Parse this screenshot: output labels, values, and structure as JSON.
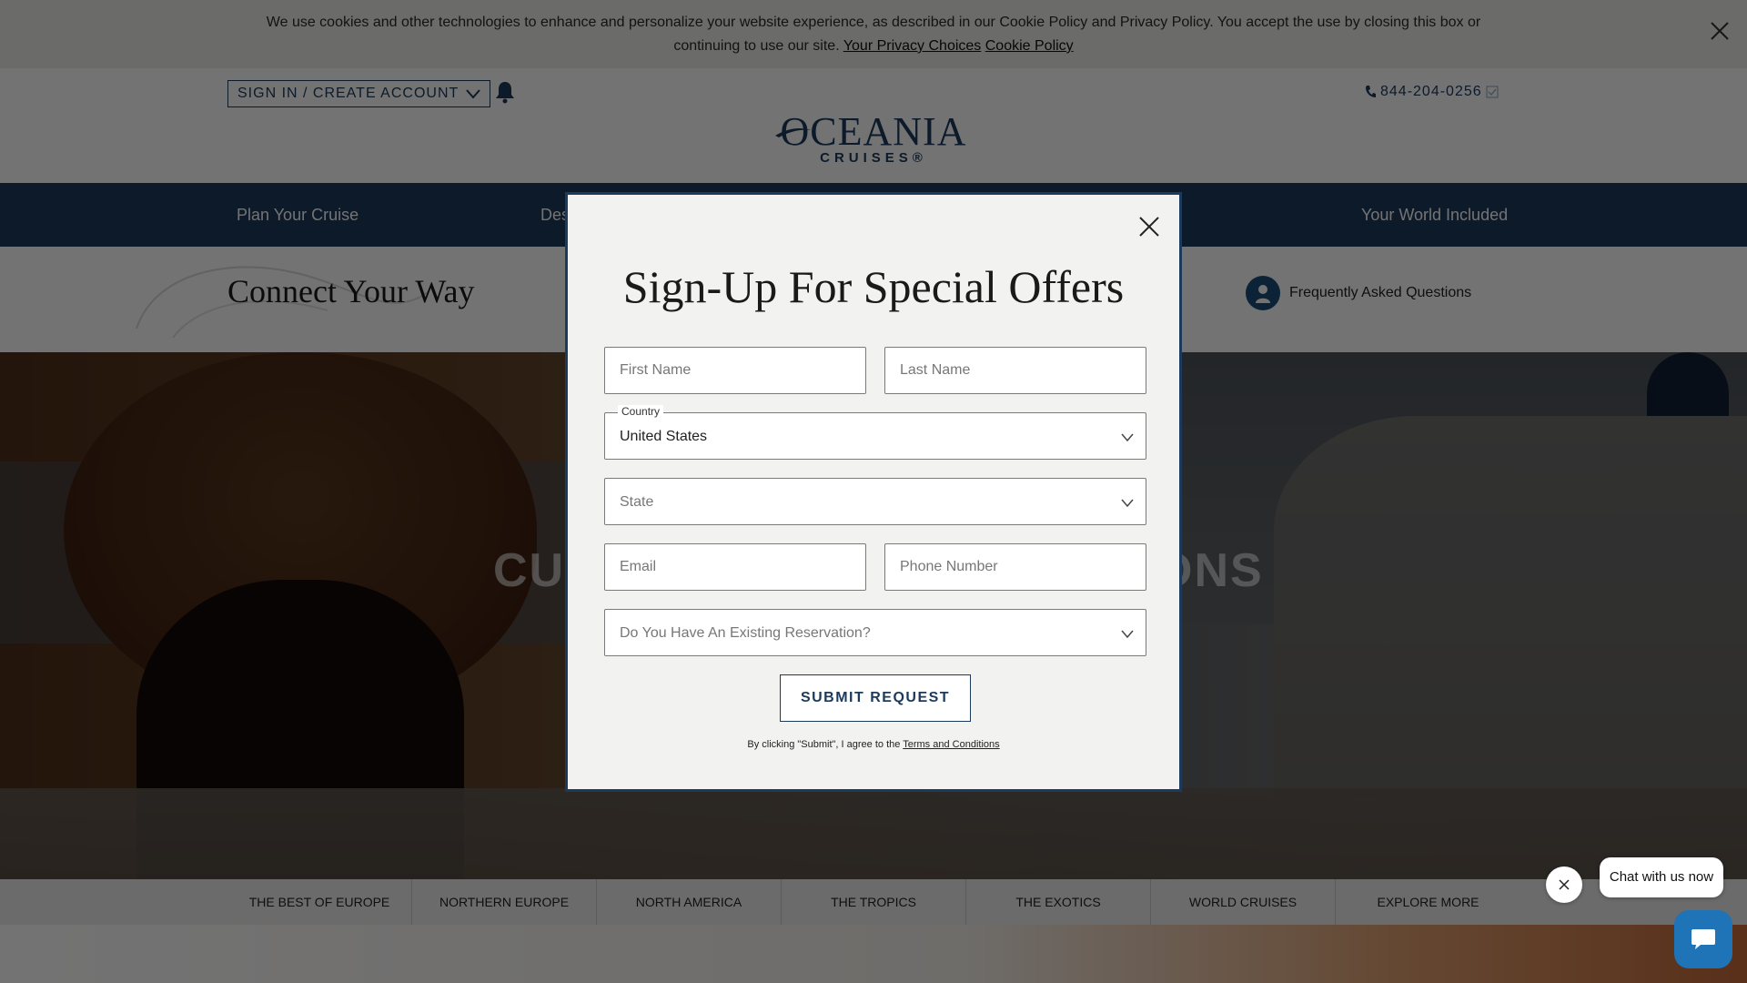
{
  "cookie": {
    "text_line1": "We use cookies and other technologies to enhance and personalize your website experience, as described in our Cookie Policy and Privacy Policy. You accept the use by closing this box or",
    "text_line2": "continuing to use our site.",
    "privacy_link": "Your Privacy Choices",
    "cookie_link": "Cookie Policy"
  },
  "header": {
    "signin_label": "SIGN IN / CREATE ACCOUNT",
    "phone": "844-204-0256",
    "logo_main": "OCEANIA",
    "logo_sub": "CRUISES®"
  },
  "nav": {
    "items": [
      "Plan Your Cruise",
      "Des",
      "Your World Included"
    ]
  },
  "subheader": {
    "title": "Connect Your Way",
    "faq_label": "Frequently Asked Questions"
  },
  "hero": {
    "text_left": "CU",
    "text_right": "ONS"
  },
  "regions": [
    "THE BEST OF EUROPE",
    "NORTHERN EUROPE",
    "NORTH AMERICA",
    "THE TROPICS",
    "THE EXOTICS",
    "WORLD CRUISES",
    "EXPLORE MORE"
  ],
  "modal": {
    "title": "Sign-Up For Special Offers",
    "first_name_placeholder": "First Name",
    "last_name_placeholder": "Last Name",
    "country_label": "Country",
    "country_value": "United States",
    "state_placeholder": "State",
    "email_placeholder": "Email",
    "phone_placeholder": "Phone Number",
    "reservation_placeholder": "Do You Have An Existing Reservation?",
    "submit_label": "SUBMIT REQUEST",
    "terms_prefix": "By clicking \"Submit\", I agree to the",
    "terms_link": "Terms and Conditions"
  },
  "chat": {
    "bubble_text": "Chat with us now"
  },
  "colors": {
    "brand_navy": "#1b3a5c",
    "chat_blue": "#1f73b7"
  }
}
